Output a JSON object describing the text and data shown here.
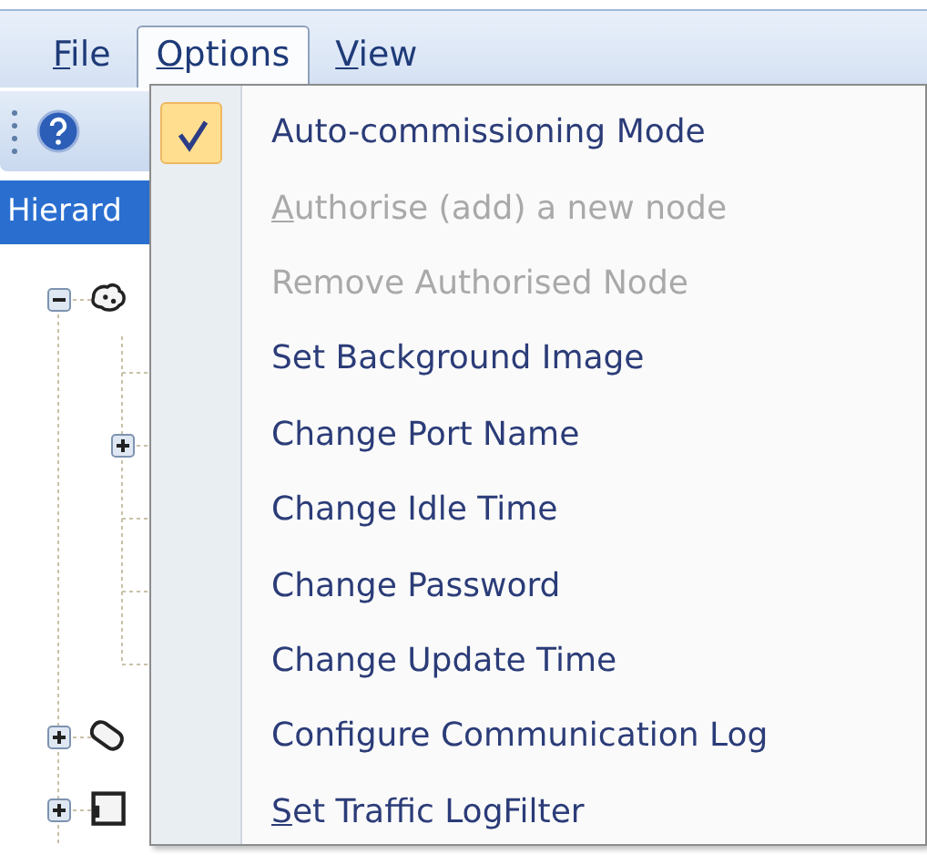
{
  "menu_bar": [
    {
      "label": "File",
      "mnemonic": true,
      "selected": false
    },
    {
      "label": "Options",
      "mnemonic": true,
      "selected": true
    },
    {
      "label": "View",
      "mnemonic": true,
      "selected": false
    }
  ],
  "panel": {
    "title": "Hierard"
  },
  "tree": [
    {
      "kind": "node",
      "expanded": true,
      "children": [
        {
          "kind": "leaf"
        },
        {
          "kind": "node",
          "expanded": false
        },
        {
          "kind": "leaf"
        },
        {
          "kind": "leaf"
        },
        {
          "kind": "leaf"
        }
      ]
    },
    {
      "kind": "node",
      "expanded": false
    },
    {
      "kind": "node",
      "expanded": false
    }
  ],
  "options_menu": [
    {
      "label": "Auto-commissioning Mode",
      "checked": true,
      "disabled": false,
      "mnemonic": false
    },
    {
      "label": "Authorise (add) a new node",
      "checked": false,
      "disabled": true,
      "mnemonic": true
    },
    {
      "label": "Remove Authorised Node",
      "checked": false,
      "disabled": true,
      "mnemonic": false
    },
    {
      "label": "Set Background Image",
      "checked": false,
      "disabled": false,
      "mnemonic": false
    },
    {
      "label": "Change Port Name",
      "checked": false,
      "disabled": false,
      "mnemonic": false
    },
    {
      "label": "Change Idle Time",
      "checked": false,
      "disabled": false,
      "mnemonic": false
    },
    {
      "label": "Change Password",
      "checked": false,
      "disabled": false,
      "mnemonic": false
    },
    {
      "label": "Change Update Time",
      "checked": false,
      "disabled": false,
      "mnemonic": false
    },
    {
      "label": "Configure Communication Log",
      "checked": false,
      "disabled": false,
      "mnemonic": false
    },
    {
      "label": "Set Traffic LogFilter",
      "checked": false,
      "disabled": false,
      "mnemonic": true
    }
  ]
}
